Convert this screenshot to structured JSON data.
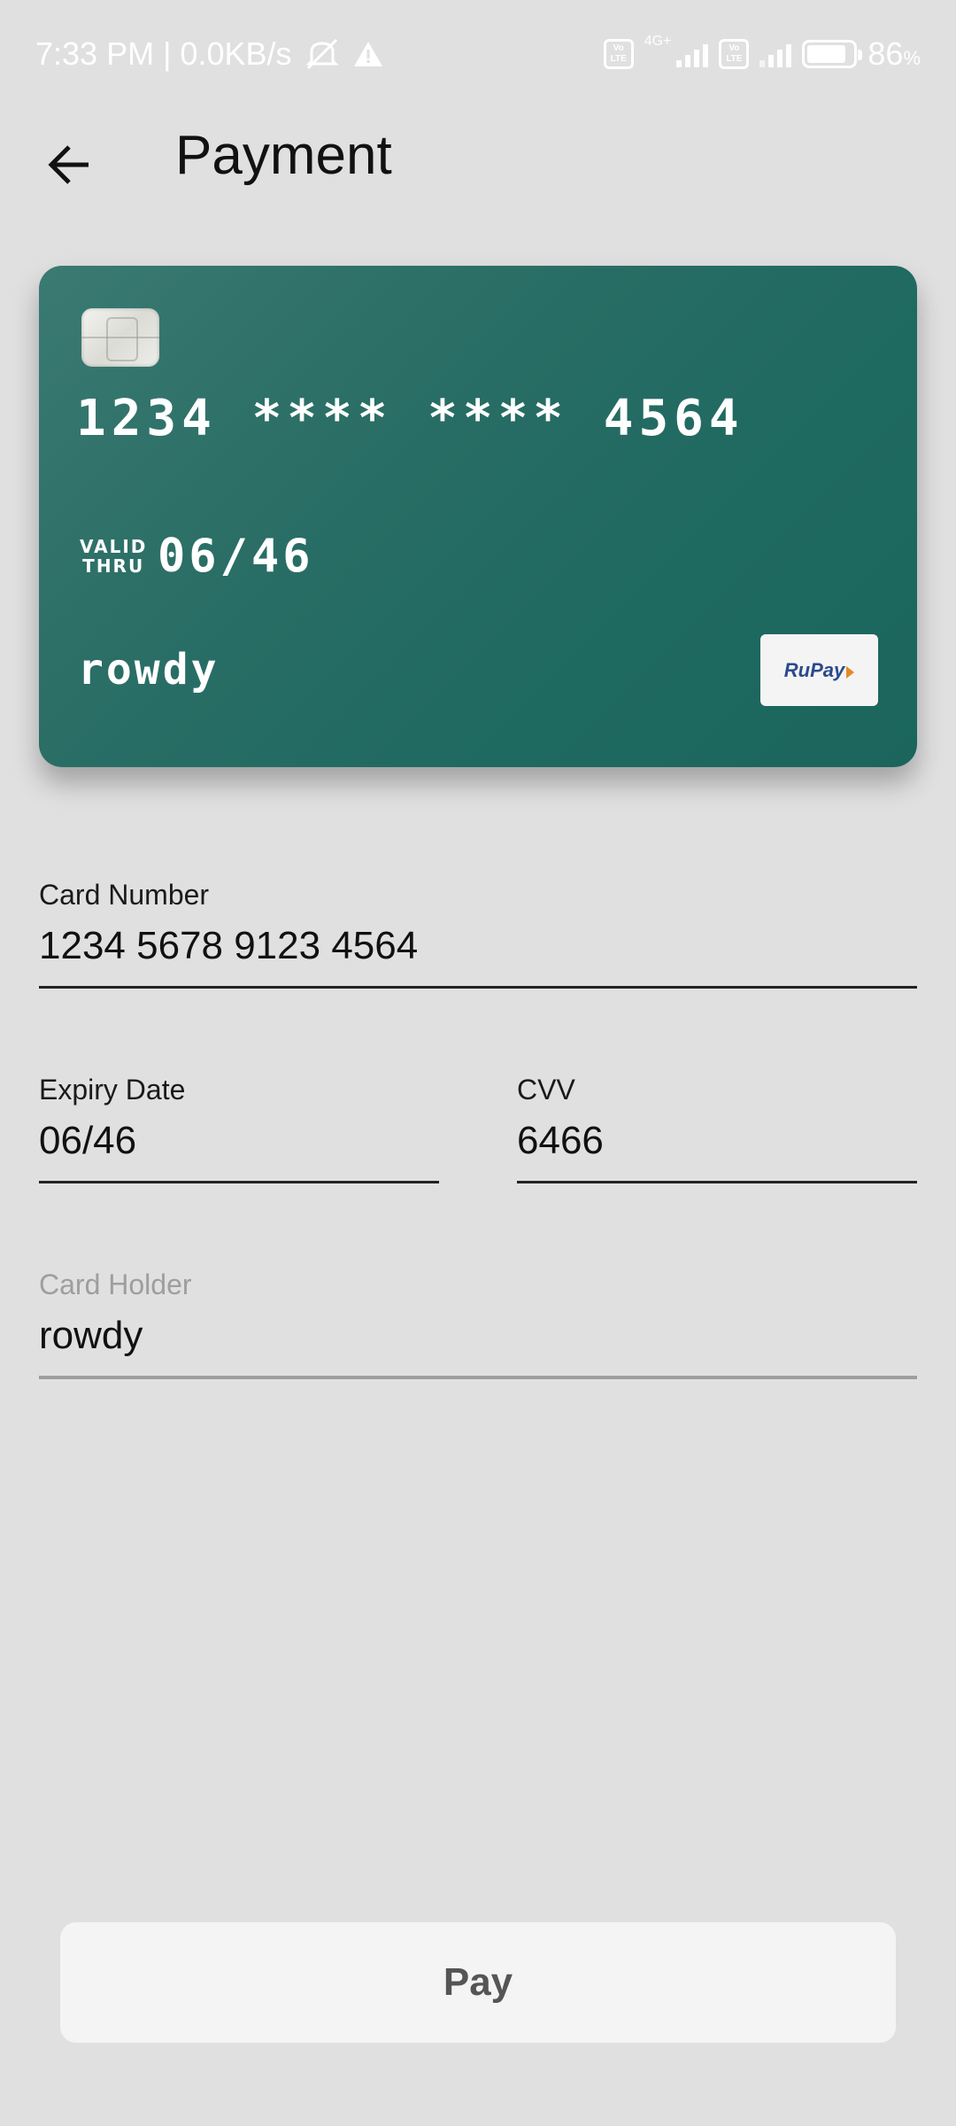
{
  "status_bar": {
    "time_speed": "7:33 PM | 0.0KB/s",
    "lte1": "Vo LTE",
    "net_type": "4G+",
    "lte2": "Vo LTE",
    "battery_percent": "86",
    "battery_unit": "%",
    "battery_level": 0.86
  },
  "app_bar": {
    "title": "Payment"
  },
  "card": {
    "number": "1234 **** **** 4564",
    "valid_thru_line1": "VALID",
    "valid_thru_line2": "THRU",
    "expiry": "06/46",
    "holder": "rowdy",
    "brand": "RuPay",
    "colors": {
      "card_bg": "#2a6e66",
      "card_text": "#ffffff"
    }
  },
  "form": {
    "card_number": {
      "label": "Card Number",
      "value": "1234 5678 9123 4564"
    },
    "expiry": {
      "label": "Expiry Date",
      "value": "06/46"
    },
    "cvv": {
      "label": "CVV",
      "value": "6466"
    },
    "holder": {
      "label": "Card Holder",
      "value": "rowdy"
    }
  },
  "pay_button": {
    "label": "Pay"
  }
}
